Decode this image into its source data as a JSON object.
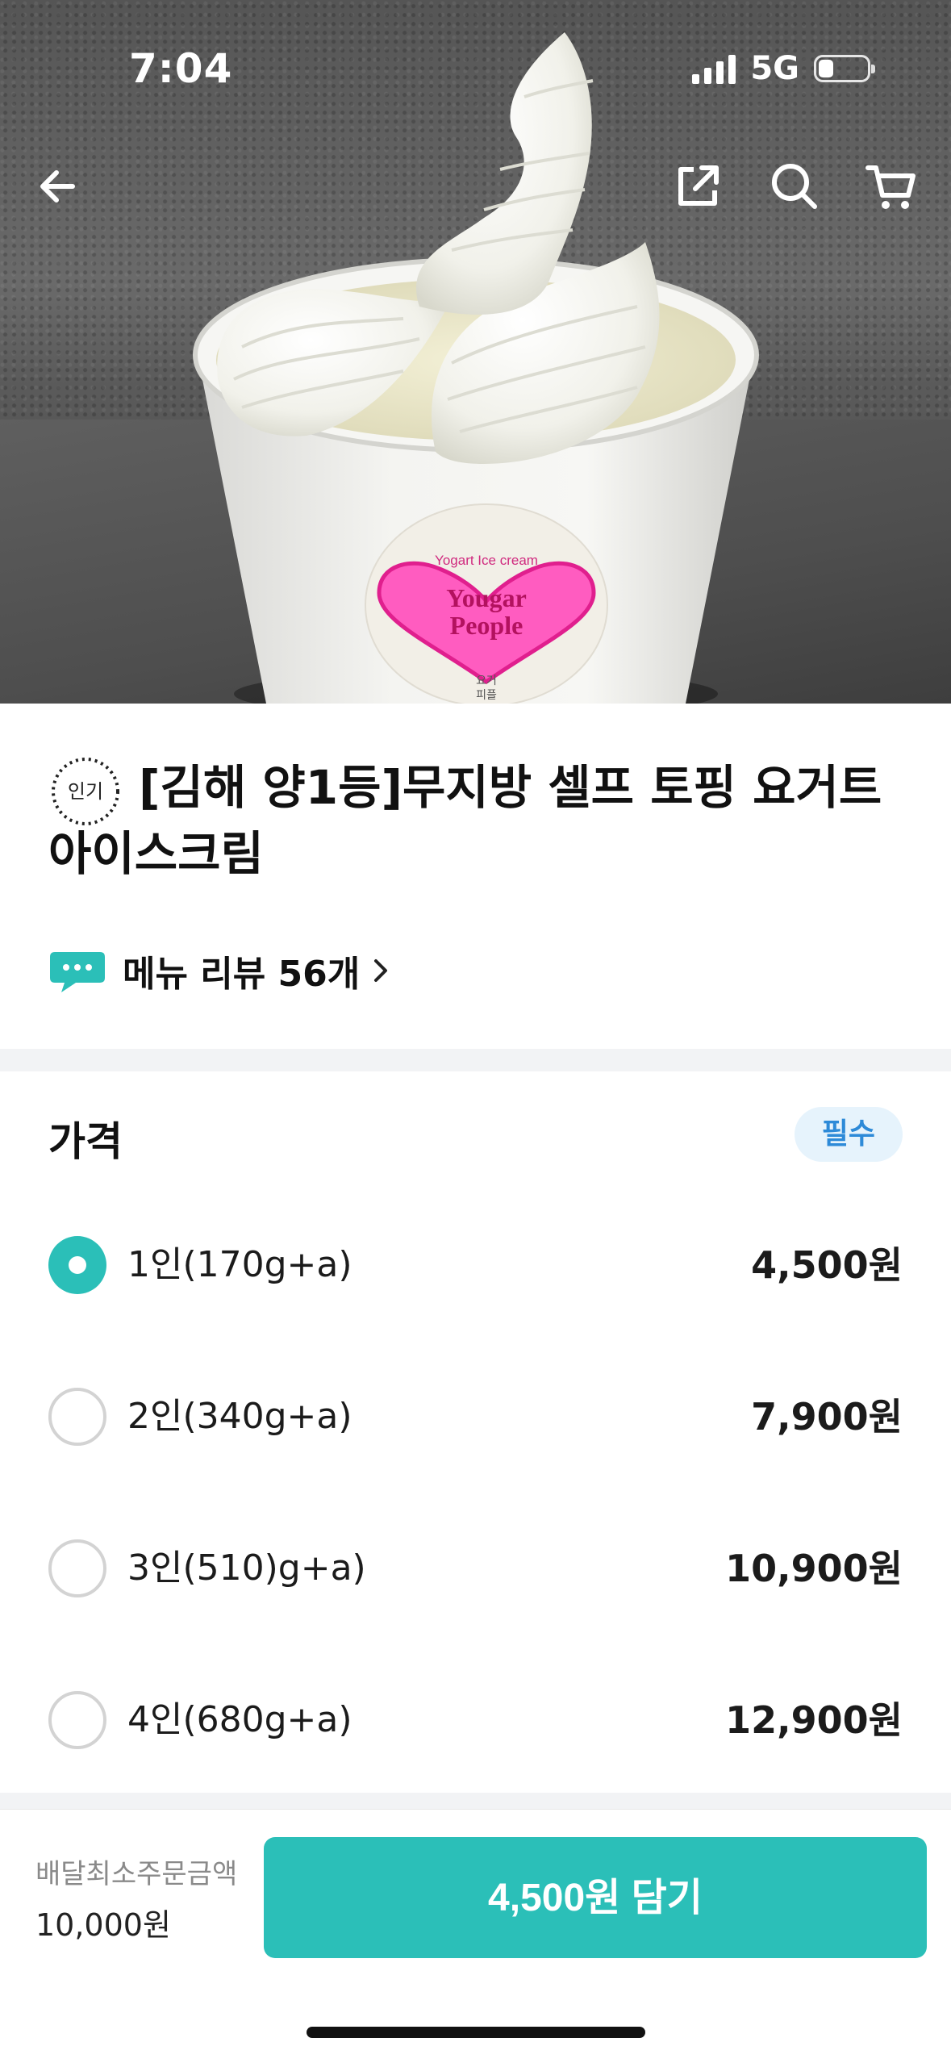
{
  "status_bar": {
    "time": "7:04",
    "network": "5G"
  },
  "product_image": {
    "cup_label_top": "Yogart Ice cream",
    "cup_brand_line1": "Yougar",
    "cup_brand_line2": "People",
    "cup_label_korean_line1": "요거",
    "cup_label_korean_line2": "피플"
  },
  "nav": {
    "icons": [
      "back-arrow-icon",
      "share-icon",
      "search-icon",
      "cart-icon"
    ]
  },
  "product": {
    "badge": "인기",
    "title": "[김해 양1등]무지방 셀프 토핑 요거트 아이스크림",
    "review_link": "메뉴 리뷰 56개"
  },
  "price_section": {
    "title": "가격",
    "required_badge": "필수",
    "options": [
      {
        "label": "1인(170g+a)",
        "price": "4,500원",
        "selected": true
      },
      {
        "label": "2인(340g+a)",
        "price": "7,900원",
        "selected": false
      },
      {
        "label": "3인(510)g+a)",
        "price": "10,900원",
        "selected": false
      },
      {
        "label": "4인(680g+a)",
        "price": "12,900원",
        "selected": false
      }
    ]
  },
  "bottom_bar": {
    "min_order_label": "배달최소주문금액",
    "min_order_value": "10,000원",
    "cta_label": "4,500원 담기"
  },
  "colors": {
    "accent": "#2bbfb8",
    "required_badge_bg": "#e6f3fc",
    "required_badge_text": "#2d8ad8",
    "divider": "#f2f3f5"
  }
}
